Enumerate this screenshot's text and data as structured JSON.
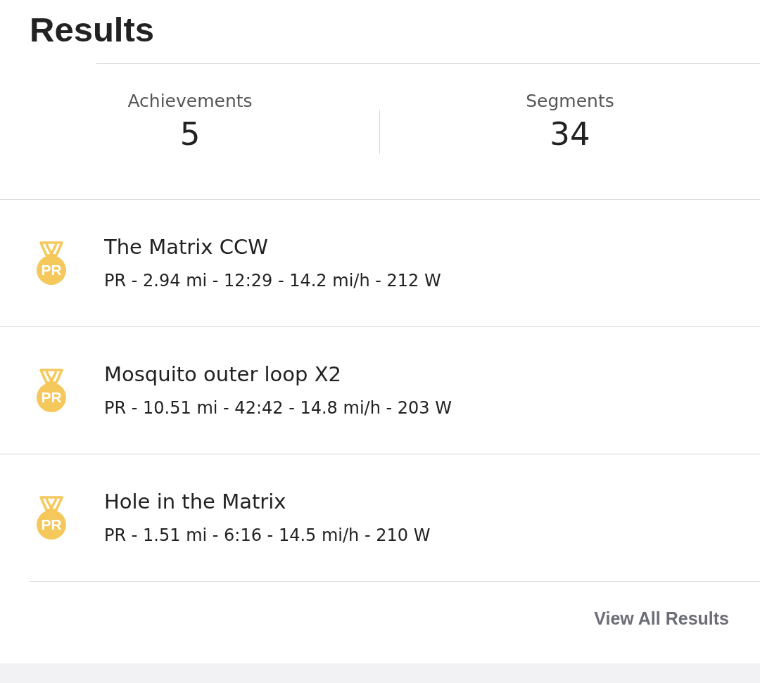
{
  "title": "Results",
  "stats": [
    {
      "label": "Achievements",
      "value": "5"
    },
    {
      "label": "Segments",
      "value": "34"
    }
  ],
  "results": [
    {
      "badge": "PR",
      "name": "The Matrix CCW",
      "details": "PR - 2.94 mi - 12:29 - 14.2 mi/h - 212 W"
    },
    {
      "badge": "PR",
      "name": "Mosquito outer loop X2",
      "details": "PR - 10.51 mi - 42:42 - 14.8 mi/h - 203 W"
    },
    {
      "badge": "PR",
      "name": "Hole in the Matrix",
      "details": "PR - 1.51 mi - 6:16 - 14.5 mi/h - 210 W"
    }
  ],
  "link": "View All Results"
}
